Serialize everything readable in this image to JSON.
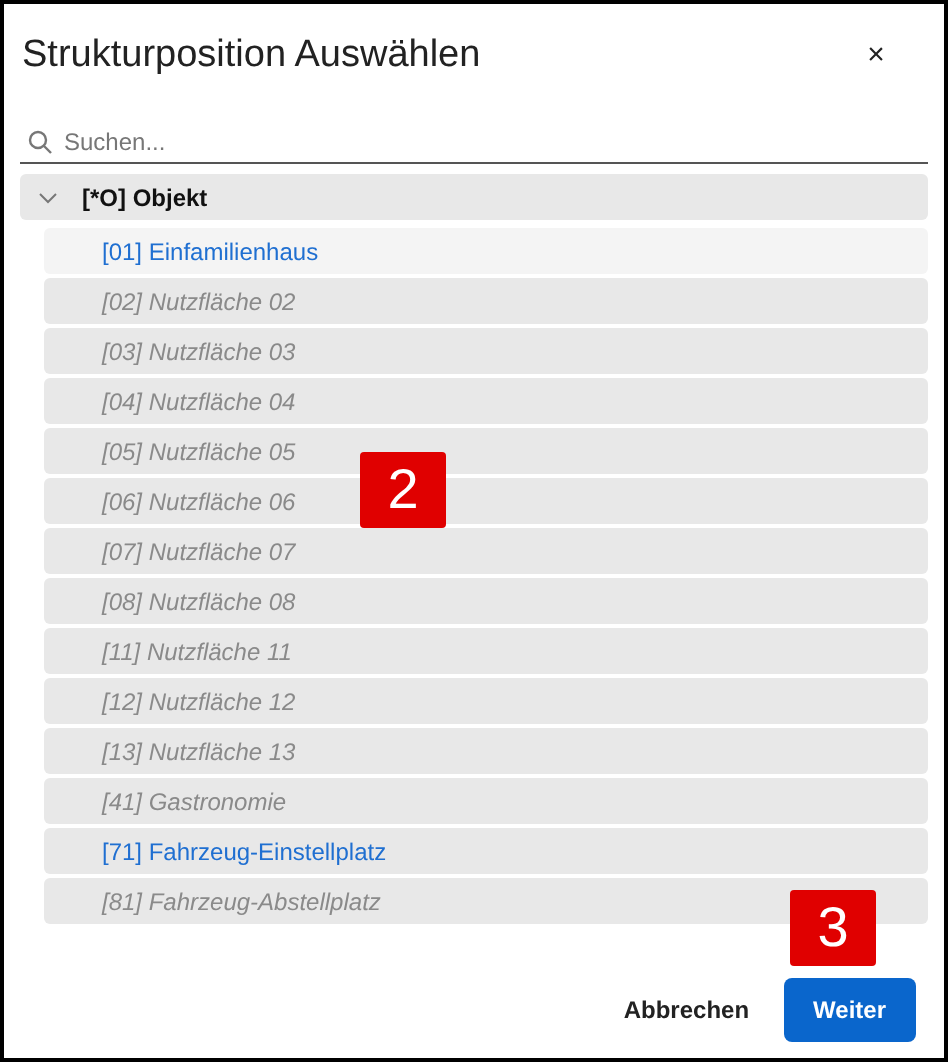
{
  "dialog": {
    "title": "Strukturposition Auswählen",
    "close": "×"
  },
  "search": {
    "placeholder": "Suchen..."
  },
  "tree": {
    "label": "[*O] Objekt",
    "expanded": true,
    "children": [
      {
        "label": "[01] Einfamilienhaus",
        "disabled": false,
        "selected": true
      },
      {
        "label": "[02] Nutzfläche 02",
        "disabled": true,
        "selected": false
      },
      {
        "label": "[03] Nutzfläche 03",
        "disabled": true,
        "selected": false
      },
      {
        "label": "[04] Nutzfläche 04",
        "disabled": true,
        "selected": false
      },
      {
        "label": "[05] Nutzfläche 05",
        "disabled": true,
        "selected": false
      },
      {
        "label": "[06] Nutzfläche 06",
        "disabled": true,
        "selected": false
      },
      {
        "label": "[07] Nutzfläche 07",
        "disabled": true,
        "selected": false
      },
      {
        "label": "[08] Nutzfläche 08",
        "disabled": true,
        "selected": false
      },
      {
        "label": "[11] Nutzfläche 11",
        "disabled": true,
        "selected": false
      },
      {
        "label": "[12] Nutzfläche 12",
        "disabled": true,
        "selected": false
      },
      {
        "label": "[13] Nutzfläche 13",
        "disabled": true,
        "selected": false
      },
      {
        "label": "[41] Gastronomie",
        "disabled": true,
        "selected": false
      },
      {
        "label": "[71] Fahrzeug-Einstellplatz",
        "disabled": false,
        "selected": false
      },
      {
        "label": "[81] Fahrzeug-Abstellplatz",
        "disabled": true,
        "selected": false
      }
    ]
  },
  "buttons": [
    {
      "label": "Abbrechen",
      "kind": "text"
    },
    {
      "label": "Weiter",
      "kind": "primary"
    }
  ],
  "annotations": [
    "2",
    "3"
  ]
}
